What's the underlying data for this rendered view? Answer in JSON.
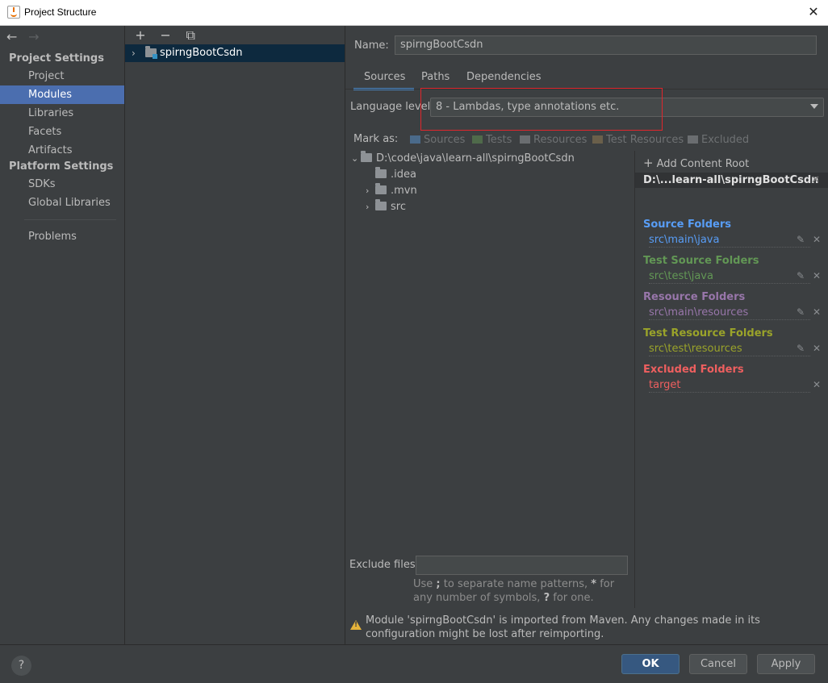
{
  "window": {
    "title": "Project Structure",
    "close": "✕"
  },
  "nav": {
    "back": "←",
    "forward": "→",
    "project_settings_title": "Project Settings",
    "project_settings": [
      "Project",
      "Modules",
      "Libraries",
      "Facets",
      "Artifacts"
    ],
    "platform_settings_title": "Platform Settings",
    "platform_settings": [
      "SDKs",
      "Global Libraries"
    ],
    "problems": "Problems",
    "selected": "Modules"
  },
  "modules": {
    "toolbar": {
      "add": "+",
      "remove": "−",
      "copy": "⧉"
    },
    "items": [
      {
        "name": "spirngBootCsdn",
        "chevron": "›"
      }
    ]
  },
  "main": {
    "name_label": "Name:",
    "name_value": "spirngBootCsdn",
    "tabs": [
      "Sources",
      "Paths",
      "Dependencies"
    ],
    "active_tab": "Sources",
    "language_level_label": "Language level:",
    "language_level_value": "8 - Lambdas, type annotations etc.",
    "mark_as_label": "Mark as:",
    "mark_as": [
      "Sources",
      "Tests",
      "Resources",
      "Test Resources",
      "Excluded"
    ],
    "tree": [
      {
        "label": "D:\\code\\java\\learn-all\\spirngBootCsdn",
        "chevron": "⌄"
      },
      {
        "label": ".idea",
        "chevron": ""
      },
      {
        "label": ".mvn",
        "chevron": "›"
      },
      {
        "label": "src",
        "chevron": "›"
      }
    ],
    "exclude_label": "Exclude files:",
    "exclude_value": "",
    "hint_parts": [
      "Use ",
      ";",
      " to separate name patterns, ",
      "*",
      " for any number of symbols, ",
      "?",
      " for one."
    ],
    "warning": "Module 'spirngBootCsdn' is imported from Maven. Any changes made in its configuration might be lost after reimporting."
  },
  "content_root": {
    "add_label": "Add Content Root",
    "root_path": "D:\\...learn-all\\spirngBootCsdn",
    "groups": [
      {
        "title": "Source Folders",
        "path": "src\\main\\java",
        "color": "#589df6",
        "editable": true
      },
      {
        "title": "Test Source Folders",
        "path": "src\\test\\java",
        "color": "#629755",
        "editable": true
      },
      {
        "title": "Resource Folders",
        "path": "src\\main\\resources",
        "color": "#9876aa",
        "editable": true
      },
      {
        "title": "Test Resource Folders",
        "path": "src\\test\\resources",
        "color": "#9aa32a",
        "editable": true
      },
      {
        "title": "Excluded Folders",
        "path": "target",
        "color": "#ee5f5f",
        "editable": false
      }
    ]
  },
  "footer": {
    "help": "?",
    "ok": "OK",
    "cancel": "Cancel",
    "apply": "Apply"
  }
}
